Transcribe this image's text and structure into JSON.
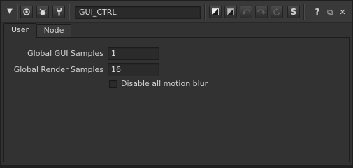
{
  "toolbar": {
    "collapse_icon": "triangle-down-icon",
    "name_value": "GUI_CTRL",
    "icons": {
      "node_color": "circle-dot-icon",
      "viewer": "bug-icon",
      "settings": "wrench-icon",
      "revert": "diagonal-split-icon",
      "revert_all": "diagonal-split-icon",
      "undo": "undo-arrow-icon",
      "redo": "redo-arrow-icon",
      "refresh": "refresh-icon"
    },
    "s_label": "S",
    "help_label": "?",
    "float_label": "⧉",
    "close_label": "✕"
  },
  "tabs": [
    {
      "label": "User",
      "active": true
    },
    {
      "label": "Node",
      "active": false
    }
  ],
  "knobs": {
    "gui_samples": {
      "label": "Global GUI Samples",
      "value": "1"
    },
    "render_samples": {
      "label": "Global Render Samples",
      "value": "16"
    },
    "motion_blur": {
      "label": "Disable all motion blur",
      "checked": false
    }
  }
}
